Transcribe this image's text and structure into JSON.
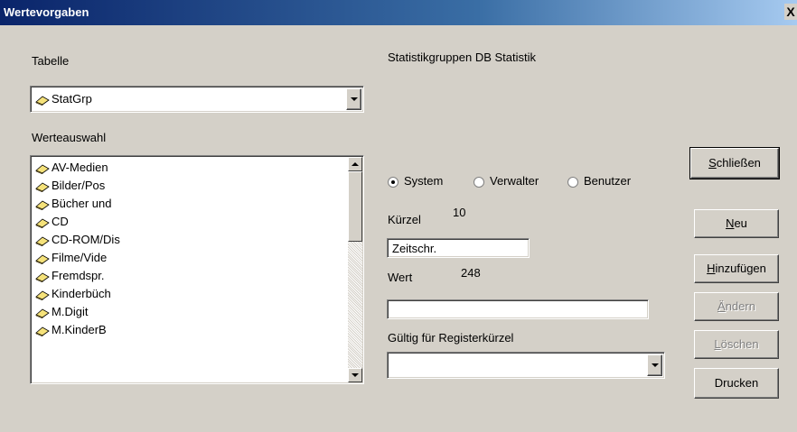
{
  "window": {
    "title": "Wertevorgaben",
    "close_glyph": "X"
  },
  "left": {
    "tabelle_label": "Tabelle",
    "tabelle_value": "StatGrp",
    "werteauswahl_label": "Werteauswahl",
    "items": [
      "AV-Medien",
      "Bilder/Pos",
      "Bücher und",
      "CD",
      "CD-ROM/Dis",
      "Filme/Vide",
      "Fremdspr.",
      "Kinderbüch",
      "M.Digit",
      "M.KinderB"
    ]
  },
  "right": {
    "heading": "Statistikgruppen DB Statistik",
    "radios": [
      {
        "label": "System",
        "checked": true
      },
      {
        "label": "Verwalter",
        "checked": false
      },
      {
        "label": "Benutzer",
        "checked": false
      }
    ],
    "kuerzel_label": "Kürzel",
    "kuerzel_count": "10",
    "kuerzel_value": "Zeitschr.",
    "wert_label": "Wert",
    "wert_count": "248",
    "wert_value": "",
    "gueltig_label": "Gültig für Registerkürzel",
    "gueltig_value": ""
  },
  "buttons": {
    "schliessen": {
      "mnemonic": "S",
      "rest": "chließen"
    },
    "neu": {
      "mnemonic": "N",
      "rest": "eu"
    },
    "hinzufuegen": {
      "mnemonic": "H",
      "rest": "inzufügen"
    },
    "aendern": {
      "mnemonic": "Ä",
      "rest": "ndern"
    },
    "loeschen": {
      "mnemonic": "L",
      "rest": "öschen"
    },
    "drucken": "Drucken"
  },
  "icons": {
    "list_item": "folder-icon",
    "combo": "chevron-down-icon"
  },
  "colors": {
    "titlebar_start": "#0a246a",
    "titlebar_end": "#a6caf0",
    "dialog_bg": "#d4d0c8"
  }
}
